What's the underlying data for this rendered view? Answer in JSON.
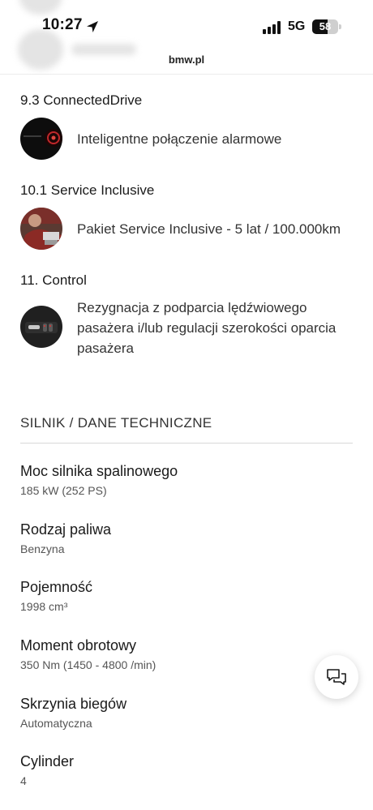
{
  "status_bar": {
    "time": "10:27",
    "network": "5G",
    "battery_percent": 58,
    "battery_label": "58",
    "url": "bmw.pl"
  },
  "features": [
    {
      "heading": "9.3 ConnectedDrive",
      "text": "Inteligentne połączenie alarmowe",
      "icon": "alarm-call-thumbnail"
    },
    {
      "heading": "10.1 Service Inclusive",
      "text": "Pakiet Service Inclusive - 5 lat / 100.000km",
      "icon": "service-mechanic-thumbnail"
    },
    {
      "heading": "11. Control",
      "text": "Rezygnacja z podparcia lędźwiowego pasażera i/lub regulacji szerokości oparcia pasażera",
      "icon": "seat-control-thumbnail"
    }
  ],
  "specs_section": {
    "title": "SILNIK / DANE TECHNICZNE",
    "items": [
      {
        "label": "Moc silnika spalinowego",
        "value": "185 kW (252 PS)"
      },
      {
        "label": "Rodzaj paliwa",
        "value": "Benzyna"
      },
      {
        "label": "Pojemność",
        "value": "1998 cm³"
      },
      {
        "label": "Moment obrotowy",
        "value": "350 Nm (1450 - 4800 /min)"
      },
      {
        "label": "Skrzynia biegów",
        "value": "Automatyczna"
      },
      {
        "label": "Cylinder",
        "value": "4"
      }
    ]
  },
  "chat_button": {
    "icon": "chat-bubbles-icon"
  },
  "colors": {
    "text": "#1a1a1a",
    "muted": "#555555",
    "divider": "#d9d9d9",
    "background": "#ffffff"
  }
}
